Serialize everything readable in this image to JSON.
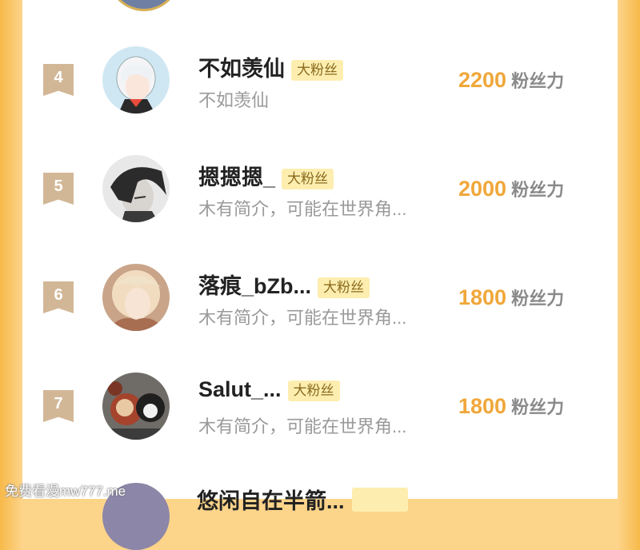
{
  "rows": [
    {
      "rank": "4",
      "name": "不如羡仙",
      "badge": "大粉丝",
      "bio": "不如羡仙",
      "fans": "2200",
      "unit": "粉丝力",
      "avatar": "avatar-white-hair"
    },
    {
      "rank": "5",
      "name": "摁摁摁_",
      "badge": "大粉丝",
      "bio": "木有简介，可能在世界角...",
      "fans": "2000",
      "unit": "粉丝力",
      "avatar": "avatar-dark-hair"
    },
    {
      "rank": "6",
      "name": "落痕_bZb...",
      "badge": "大粉丝",
      "bio": "木有简介，可能在世界角...",
      "fans": "1800",
      "unit": "粉丝力",
      "avatar": "avatar-blonde"
    },
    {
      "rank": "7",
      "name": "Salut_...",
      "badge": "大粉丝",
      "bio": "木有简介，可能在世界角...",
      "fans": "1800",
      "unit": "粉丝力",
      "avatar": "avatar-plush-toys"
    }
  ],
  "partial_row": {
    "name": "悠闲自在半箭..."
  },
  "watermark": "免费看漫mw777.me",
  "colors": {
    "accent": "#f0a73a",
    "badge_bg": "#fdeeb0",
    "rank_bg": "#d2b797",
    "frame": "#f8b94a"
  }
}
